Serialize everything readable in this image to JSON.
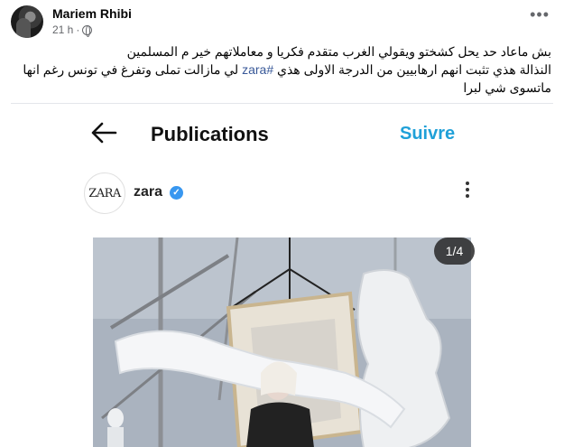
{
  "post": {
    "author": "Mariem Rhibi",
    "time": "21 h",
    "separator": "·",
    "text_lines": {
      "line1": "بش ماعاد حد يحل كشختو ويقولي الغرب متقدم فكريا و معاملاتهم خير م المسلمين",
      "line2_before": "النذالة هذي تثبت انهم ارهابيين من الدرجة الاولى هذي ",
      "hashtag": "#zara",
      "line2_after": " لي مازالت تملى وتفرغ في تونس رغم انها",
      "line3": "ماتسوى شي لبرا"
    }
  },
  "shared_screenshot": {
    "header_title": "Publications",
    "follow_label": "Suivre",
    "account": {
      "logo_text": "ZARA",
      "username": "zara",
      "verified_mark": "✓"
    },
    "photo_counter": "1/4"
  },
  "icons": {
    "globe": "globe-icon",
    "more": "more-icon",
    "back": "arrow-left-icon",
    "verified": "verified-icon",
    "post_menu": "vertical-ellipsis-icon"
  },
  "colors": {
    "hashtag": "#385898",
    "follow": "#1fa0d8",
    "verified": "#3897f0"
  }
}
